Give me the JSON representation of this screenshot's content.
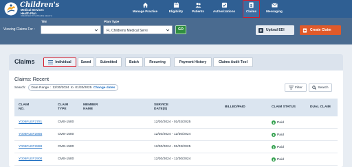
{
  "brand": {
    "line1": "Children's",
    "line2": "Medical Services",
    "line3": "Health Plan",
    "line4": "OPERATED BY SUNSHINE HEALTH"
  },
  "nav": {
    "items": [
      {
        "label": "Manage Practice",
        "icon": "home-icon"
      },
      {
        "label": "Eligibility",
        "icon": "calendar-icon"
      },
      {
        "label": "Patients",
        "icon": "people-icon"
      },
      {
        "label": "Authorizations",
        "icon": "checkbox-icon"
      },
      {
        "label": "Claims",
        "icon": "dollar-doc-icon",
        "active": true
      },
      {
        "label": "Messaging",
        "icon": "envelope-icon"
      }
    ]
  },
  "subbar": {
    "viewing_label": "Viewing Claims For :",
    "tin_label": "TIN",
    "tin_value": "",
    "plan_type_label": "Plan Type",
    "plan_type_value": "FL Childrens Medical Servi",
    "go_label": "GO",
    "upload_label": "Upload EDI",
    "create_label": "Create Claim"
  },
  "claims": {
    "title": "Claims",
    "tabs": [
      {
        "label": "Individual",
        "active": true
      },
      {
        "label": "Saved"
      },
      {
        "label": "Submitted"
      },
      {
        "label": "Batch"
      },
      {
        "label": "Recurring"
      },
      {
        "label": "Payment History"
      },
      {
        "label": "Claims Audit Tool"
      }
    ],
    "subtitle": "Claims: Recent",
    "search_label": "Search:",
    "date_range_label": "Date Range :",
    "date_from": "12/30/2024",
    "date_to_word": "to",
    "date_to": "01/30/2025",
    "change_dates": "Change dates",
    "filter_label": "Filter",
    "search_button": "Search"
  },
  "table": {
    "headers": {
      "claim_no_1": "CLAIM",
      "claim_no_2": "NO.",
      "claim_type_1": "CLAIM",
      "claim_type_2": "TYPE",
      "member_1": "MEMBER",
      "member_2": "NAME",
      "service_1": "SERVICE",
      "service_2": "DATE(S)",
      "billed": "BILLED/PAID",
      "status": "CLAIM STATUS",
      "dual": "DUAL CLAIM"
    },
    "rows": [
      {
        "claim_no": "Y006FLEF2781",
        "type": "CMS-1500",
        "member": "",
        "service": "12/30/2024 - 01/02/2025",
        "billed": "",
        "status": "Paid",
        "dual": ""
      },
      {
        "claim_no": "Y006FLEF2866",
        "type": "CMS-1500",
        "member": "",
        "service": "12/30/2024 - 12/30/2024",
        "billed": "",
        "status": "Paid",
        "dual": ""
      },
      {
        "claim_no": "Y006FLEF2888",
        "type": "CMS-1500",
        "member": "",
        "service": "12/30/2024 - 01/03/2025",
        "billed": "",
        "status": "Paid",
        "dual": ""
      },
      {
        "claim_no": "Y006FLEF2900",
        "type": "CMS-1500",
        "member": "",
        "service": "12/30/2024 - 12/30/2024",
        "billed": "",
        "status": "Paid",
        "dual": ""
      }
    ]
  },
  "colors": {
    "nav_bg": "#2f5f93",
    "subbar_bg": "#4a6b90",
    "highlight": "#d61a2a",
    "create_btn": "#e05a2a",
    "go_btn": "#2f8e3f",
    "link": "#1f6fc2",
    "paid": "#2e9e4a"
  }
}
